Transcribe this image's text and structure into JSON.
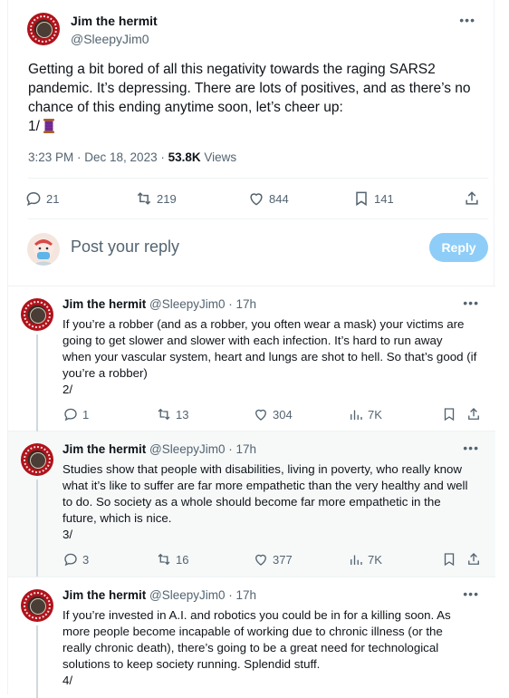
{
  "main_tweet": {
    "author_name": "Jim the hermit",
    "handle": "@SleepyJim0",
    "text_lines": [
      "Getting a bit bored of all this negativity towards the raging SARS2",
      "pandemic. It’s depressing. There are lots of positives, and as there’s no",
      "chance of this ending anytime soon, let’s cheer up:",
      "1/"
    ],
    "time": "3:23 PM · Dec 18, 2023 · ",
    "views_count": "53.8K",
    "views_label": " Views",
    "replies": "21",
    "reposts": "219",
    "likes": "844",
    "bookmarks": "141"
  },
  "composer": {
    "placeholder": "Post your reply",
    "button": "Reply"
  },
  "replies": [
    {
      "author_name": "Jim the hermit",
      "handle_time": " @SleepyJim0 · 17h",
      "text_lines": [
        "If you’re a robber (and as a robber, you often wear a mask) your victims are",
        "going to get slower and slower with each infection. It’s hard to run away",
        "when your vascular system, heart and lungs are shot to hell. So that’s good (if",
        "you’re a robber)",
        "2/"
      ],
      "replies": "1",
      "reposts": "13",
      "likes": "304",
      "views": "7K"
    },
    {
      "author_name": "Jim the hermit",
      "handle_time": " @SleepyJim0 · 17h",
      "text_lines": [
        "Studies show that people with disabilities, living in poverty, who really know",
        "what it’s like to suffer are far more empathetic than the very healthy and well",
        "to do. So society as a whole should become far more empathetic in the",
        "future, which is nice.",
        "3/"
      ],
      "replies": "3",
      "reposts": "16",
      "likes": "377",
      "views": "7K"
    },
    {
      "author_name": "Jim the hermit",
      "handle_time": " @SleepyJim0 · 17h",
      "text_lines": [
        "If you’re invested in A.I. and robotics you could be in for a killing soon. As",
        "more people become incapable of working due to chronic illness (or the",
        "really chronic death), there’s going to be a great need for technological",
        "solutions to keep society running. Splendid stuff.",
        "4/"
      ]
    }
  ],
  "more_label": "•••",
  "colors": {
    "accent": "#1d9bf0",
    "reply_button": "#8ecdf8",
    "muted": "#536471",
    "thread_bg": "#f7f9f9"
  }
}
